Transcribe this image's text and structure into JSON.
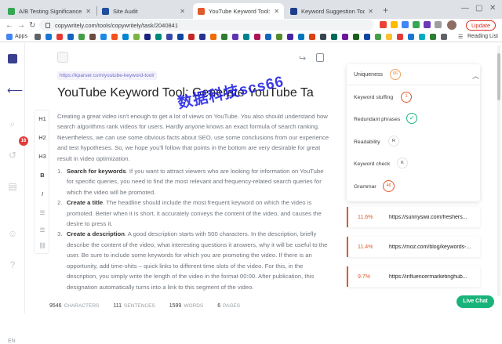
{
  "browser": {
    "tabs": [
      {
        "label": "A/B Testing Significance Calcul",
        "active": false,
        "favicon": "green-sheet-icon"
      },
      {
        "label": "Site Audit",
        "active": false,
        "favicon": "blue-v-icon"
      },
      {
        "label": "YouTube Keyword Tool: Genera",
        "active": true,
        "favicon": "keyword-tool-icon"
      },
      {
        "label": "Keyword Suggestion Tool: Keyw",
        "active": false,
        "favicon": "k-icon"
      }
    ],
    "url": "copywritely.com/tools/copywritely/task/2040841",
    "bookmarks_apps": "Apps",
    "reading_list": "Reading List",
    "update_button": "Update"
  },
  "sidebar": {
    "notification_count": "16",
    "language": "EN"
  },
  "formatting": {
    "items": [
      "H1",
      "H2",
      "H3",
      "B",
      "I"
    ]
  },
  "editor": {
    "source_url": "https://kparser.com/youtube-keyword-tool/",
    "title": "YouTube Keyword Tool: Generate YouTube Ta",
    "intro": "Creating a great video isn't enough to get a lot of views on YouTube. You also should understand how search algorithms rank videos for users. Hardly anyone knows an exact formula of search ranking. Nevertheless, we can use some obvious facts about SEO, use some conclusions from our experience and test hypotheses.  So, we hope you'll follow that points in the bottom are very desirable for great result in video optimization.",
    "list": [
      {
        "num": "1.",
        "heading": "Search for keywords",
        "text": ". If you want to attract viewers who are looking for information on YouTube for specific queries, you need to find the most relevant and frequency-related search queries for which the video will be promoted."
      },
      {
        "num": "2.",
        "heading": "Create a title",
        "text": ". The headline should include the most frequent keyword on which the video is promoted. Better when it is short, it accurately conveys the content of the video, and causes the desire to press it."
      },
      {
        "num": "3.",
        "heading": "Create a description",
        "text": ". A good description starts with 500 characters. In the description, briefly describe the content of the video, what interesting questions it answers, why it will be useful to the user. Be sure to include some keywords for which you are promoting the video. If there is an opportunity, add time-shits – quick links to different time slots of the video. For this, in the description, you simply write the length of the video in the format 00:00. After publication, this designation automatically turns into a link to this segment of the video."
      }
    ],
    "watermark": "数据科技scs66"
  },
  "status": {
    "characters_value": "9546",
    "characters_label": "CHARACTERS",
    "sentences_value": "111",
    "sentences_label": "SENTENCES",
    "words_value": "1599",
    "words_label": "WORDS",
    "pages_value": "6",
    "pages_label": "PAGES"
  },
  "analysis": {
    "uniqueness_label": "Uniqueness",
    "uniqueness_value": "66",
    "rows": [
      {
        "label": "Keyword stuffing",
        "value": "1",
        "ring": "#e05a2b"
      },
      {
        "label": "Redundant phrases",
        "value": "",
        "ring": "#19b37a"
      },
      {
        "label": "Readability",
        "value": "R",
        "ring": "#c8ccd1"
      },
      {
        "label": "Keyword check",
        "value": "K",
        "ring": "#c8ccd1"
      },
      {
        "label": "Grammar",
        "value": "46",
        "ring": "#e05a2b"
      }
    ],
    "results": [
      {
        "pct": "11.6%",
        "url": "https://sunnysiwi.com/freshers..."
      },
      {
        "pct": "11.4%",
        "url": "https://moz.com/blog/keywords-..."
      },
      {
        "pct": "9.7%",
        "url": "https://influencermarketinghub..."
      }
    ]
  },
  "livechat": "Live Chat",
  "colors": {
    "accent": "#e05a2b",
    "success": "#19b37a",
    "link": "#6d6ec7"
  }
}
